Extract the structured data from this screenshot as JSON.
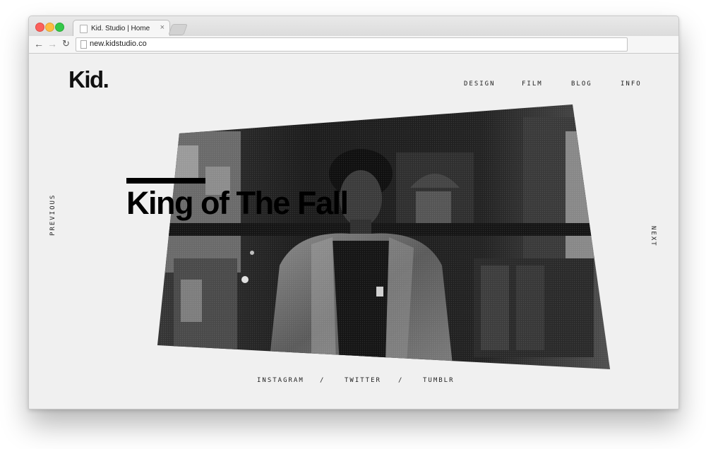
{
  "browser": {
    "tab_title": "Kid. Studio | Home",
    "tab_close": "×",
    "url": "new.kidstudio.co",
    "back_glyph": "←",
    "forward_glyph": "→",
    "reload_glyph": "↻"
  },
  "site": {
    "logo": "Kid.",
    "nav": [
      "DESIGN",
      "FILM",
      "BLOG",
      "INFO"
    ],
    "hero": {
      "title": "King of The Fall",
      "image_desc_icon": "photo-image"
    },
    "previous_label": "PREVIOUS",
    "next_label": "NEXT",
    "social": [
      "INSTAGRAM",
      "TWITTER",
      "TUMBLR"
    ],
    "social_separator": "/"
  },
  "colors": {
    "page_bg": "#f0f0f0",
    "text": "#111111",
    "photo_dark": "#1a1a1a"
  }
}
